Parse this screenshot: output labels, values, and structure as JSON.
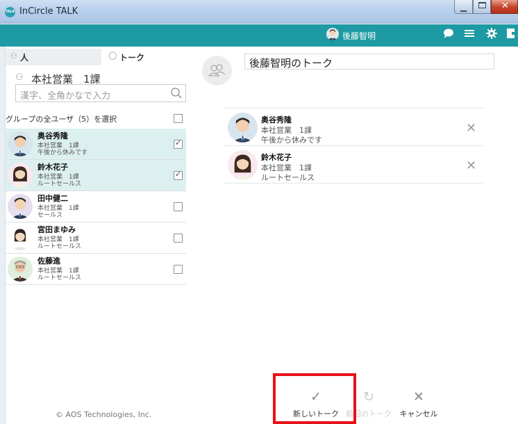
{
  "window": {
    "title": "InCircle TALK",
    "icon_label": "TALK"
  },
  "header": {
    "user_name": "後藤智明",
    "icons": [
      "chat-bubble-icon",
      "menu-icon",
      "gear-icon",
      "exit-icon"
    ],
    "color": "#1d9aa3"
  },
  "left": {
    "tabs": [
      {
        "label": "人",
        "icon": "person-icon",
        "active": true
      },
      {
        "label": "トーク",
        "icon": "speech-bubble-icon",
        "active": false
      }
    ],
    "group_name": "本社営業　1課",
    "search": {
      "placeholder": "漢字、全角かなで入力"
    },
    "select_all_label": "グループの全ユーザ（5）を選択",
    "users": [
      {
        "name": "奥谷秀隆",
        "dept": "本社営業　1課",
        "status": "午後から休みです",
        "checked": true
      },
      {
        "name": "鈴木花子",
        "dept": "本社営業　1課",
        "status": "ルートセールス",
        "checked": true
      },
      {
        "name": "田中健二",
        "dept": "本社営業　1課",
        "status": "セールス",
        "checked": false
      },
      {
        "name": "宮田まゆみ",
        "dept": "本社営業　1課",
        "status": "ルートセールス",
        "checked": false
      },
      {
        "name": "佐藤進",
        "dept": "本社営業　1課",
        "status": "ルートセールス",
        "checked": false
      }
    ],
    "copyright": "© AOS Technologies, Inc."
  },
  "right": {
    "talk_title": "後藤智明のトーク",
    "members": [
      {
        "name": "奥谷秀隆",
        "dept": "本社営業　1課",
        "status": "午後から休みです"
      },
      {
        "name": "鈴木花子",
        "dept": "本社営業　1課",
        "status": "ルートセールス"
      }
    ]
  },
  "actions": [
    {
      "label": "新しいトーク",
      "icon": "check-icon",
      "enabled": true
    },
    {
      "label": "前回のトーク",
      "icon": "refresh-icon",
      "enabled": false
    },
    {
      "label": "キャンセル",
      "icon": "close-icon",
      "enabled": true
    }
  ],
  "highlight_color": "#e8111a"
}
